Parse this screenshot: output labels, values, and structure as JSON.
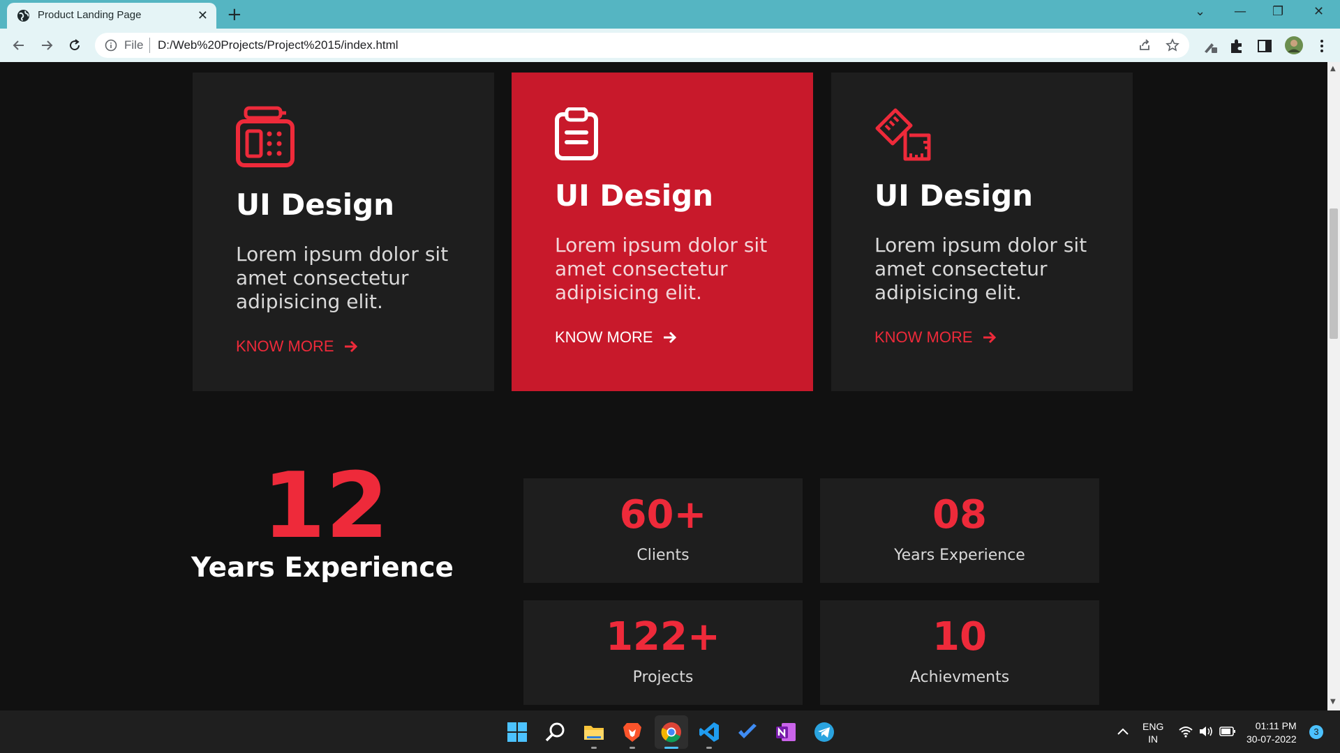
{
  "browser": {
    "tab_title": "Product Landing Page",
    "address_scheme": "File",
    "address_url": "D:/Web%20Projects/Project%2015/index.html"
  },
  "services": [
    {
      "title": "UI Design",
      "text": "Lorem ipsum dolor sit amet consectetur adipisicing elit.",
      "link": "KNOW MORE",
      "icon": "fax-machine-icon",
      "active": false
    },
    {
      "title": "UI Design",
      "text": "Lorem ipsum dolor sit amet consectetur adipisicing elit.",
      "link": "KNOW MORE",
      "icon": "clipboard-icon",
      "active": true
    },
    {
      "title": "UI Design",
      "text": "Lorem ipsum dolor sit amet consectetur adipisicing elit.",
      "link": "KNOW MORE",
      "icon": "ruler-pencil-icon",
      "active": false
    }
  ],
  "experience": {
    "number": "12",
    "label": "Years Experience"
  },
  "stats": [
    {
      "value": "60+",
      "label": "Clients"
    },
    {
      "value": "08",
      "label": "Years Experience"
    },
    {
      "value": "122+",
      "label": "Projects"
    },
    {
      "value": "10",
      "label": "Achievments"
    }
  ],
  "taskbar": {
    "apps": [
      "windows-start-icon",
      "search-icon",
      "file-explorer-icon",
      "brave-icon",
      "chrome-icon",
      "vscode-icon",
      "todo-icon",
      "onenote-icon",
      "telegram-icon"
    ],
    "lang_line1": "ENG",
    "lang_line2": "IN",
    "time": "01:11 PM",
    "date": "30-07-2022",
    "notifications": "3"
  },
  "colors": {
    "accent": "#ee2a3a",
    "active_card": "#c8192b",
    "card_bg": "#1e1e1e",
    "page_bg": "#111111"
  }
}
